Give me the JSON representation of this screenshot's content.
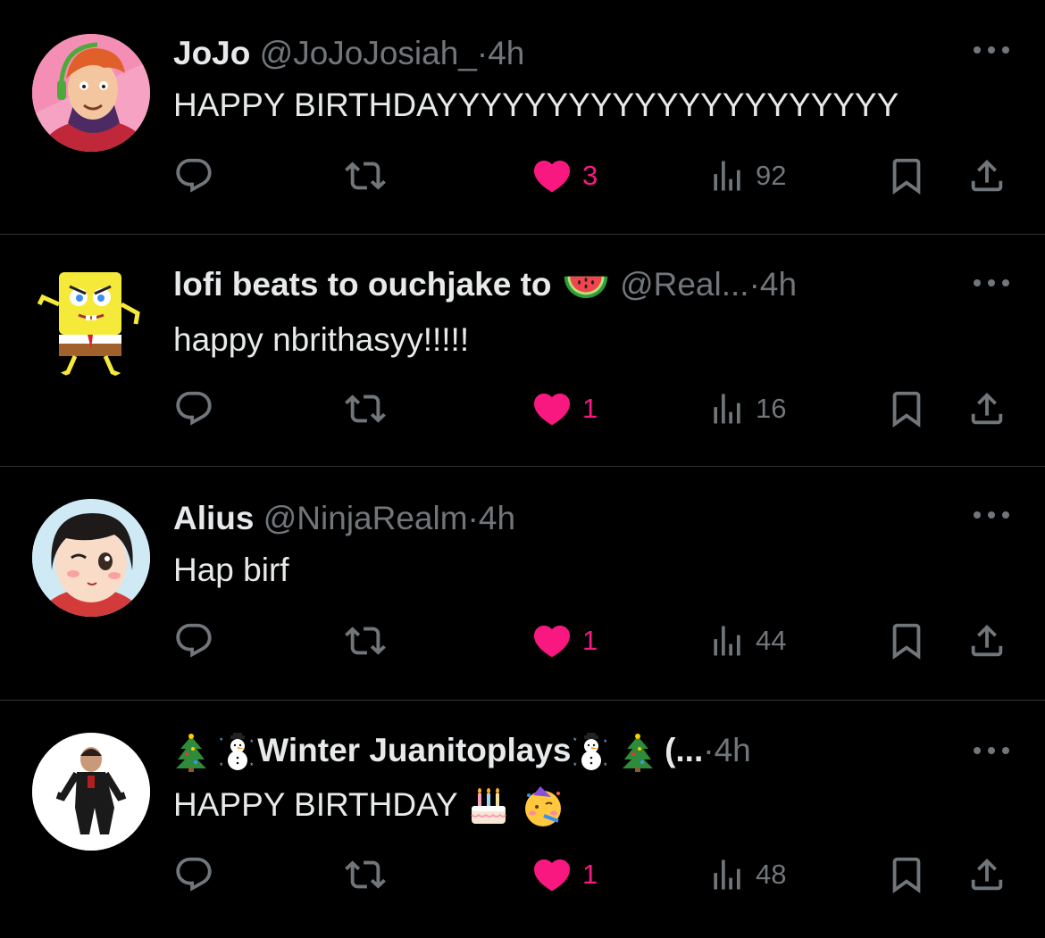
{
  "tweets": [
    {
      "name": "JoJo",
      "handle": "@JoJoJosiah_",
      "separator": "·",
      "time": "4h",
      "text": "HAPPY BIRTHDAYYYYYYYYYYYYYYYYYYYYY",
      "likes": "3",
      "views": "92"
    },
    {
      "name": "lofi beats to ouchjake to",
      "handle": "@Real...",
      "separator": "·",
      "time": "4h",
      "text": "happy nbrithasyy!!!!!",
      "likes": "1",
      "views": "16"
    },
    {
      "name": "Alius",
      "handle": "@NinjaRealm",
      "separator": "·",
      "time": "4h",
      "text": "Hap birf",
      "likes": "1",
      "views": "44"
    },
    {
      "name": "Winter Juanitoplays",
      "name_suffix": "(...",
      "separator": "·",
      "time": "4h",
      "text": "HAPPY BIRTHDAY",
      "likes": "1",
      "views": "48"
    }
  ],
  "colors": {
    "like": "#f91880",
    "muted": "#71767b",
    "text": "#e7e9ea",
    "divider": "#2f3336"
  },
  "icons": [
    "reply-icon",
    "retweet-icon",
    "heart-icon",
    "views-icon",
    "bookmark-icon",
    "share-icon",
    "more-icon"
  ]
}
